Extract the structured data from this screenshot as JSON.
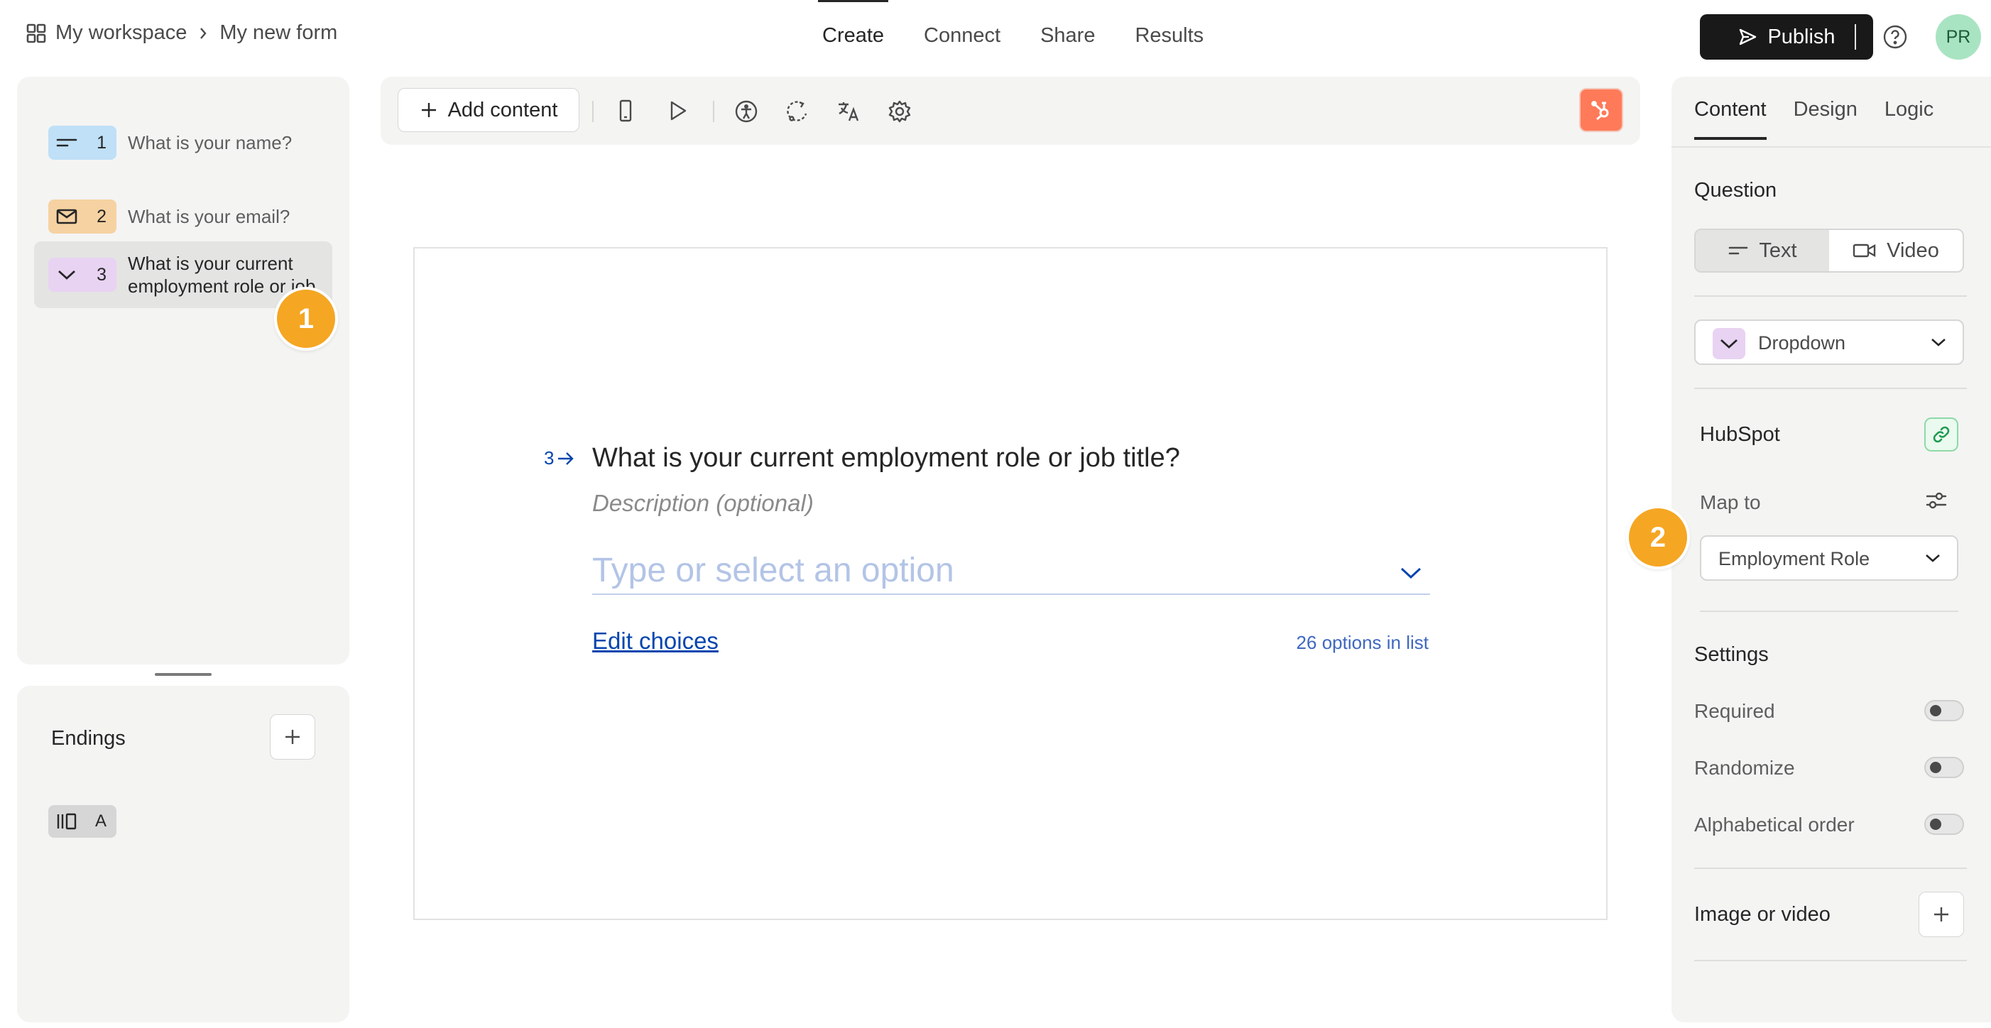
{
  "breadcrumb": {
    "workspace": "My workspace",
    "form": "My new form"
  },
  "nav": {
    "tabs": [
      "Create",
      "Connect",
      "Share",
      "Results"
    ],
    "active": "Create"
  },
  "header": {
    "publish_label": "Publish",
    "avatar_initials": "PR"
  },
  "questions": [
    {
      "number": "1",
      "text": "What is your name?",
      "type_icon": "short-text-icon",
      "color": "#bfe0f7"
    },
    {
      "number": "2",
      "text": "What is your email?",
      "type_icon": "mail-icon",
      "color": "#f6d2a2"
    },
    {
      "number": "3",
      "text": "What is your current employment role or job title?",
      "type_icon": "chevron-down-icon",
      "color": "#e8d3f2"
    }
  ],
  "endings": {
    "title": "Endings",
    "items": [
      {
        "label": "A"
      }
    ]
  },
  "toolbar": {
    "add_content_label": "Add content"
  },
  "canvas": {
    "question_number": "3",
    "question_title": "What is your current employment role or job title?",
    "description_placeholder": "Description (optional)",
    "dropdown_placeholder": "Type or select an option",
    "edit_choices_label": "Edit choices",
    "options_count_label": "26 options in list"
  },
  "right_panel": {
    "tabs": [
      "Content",
      "Design",
      "Logic"
    ],
    "active_tab": "Content",
    "question_heading": "Question",
    "text_label": "Text",
    "video_label": "Video",
    "question_type": "Dropdown",
    "hubspot_label": "HubSpot",
    "map_to_label": "Map to",
    "map_to_value": "Employment Role",
    "settings_heading": "Settings",
    "settings": [
      {
        "label": "Required",
        "enabled": false
      },
      {
        "label": "Randomize",
        "enabled": false
      },
      {
        "label": "Alphabetical order",
        "enabled": false
      }
    ],
    "image_or_video_label": "Image or video"
  },
  "markers": [
    "1",
    "2"
  ],
  "colors": {
    "accent": "#0445af",
    "marker": "#f5a623",
    "hubspot": "#ff7a59",
    "publish_bg": "#191919"
  }
}
